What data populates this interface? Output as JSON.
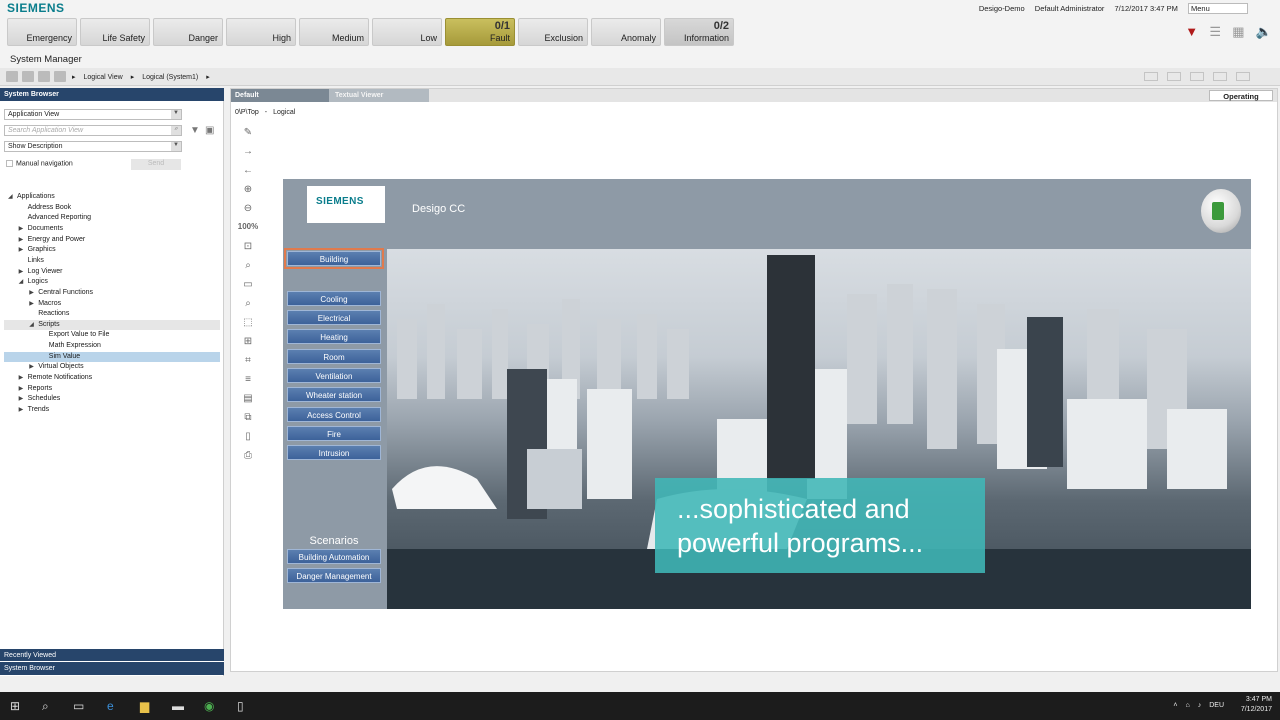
{
  "app": {
    "logo": "SIEMENS",
    "window_title": "System Manager"
  },
  "alarms": [
    {
      "label": "Emergency",
      "count": ""
    },
    {
      "label": "Life Safety",
      "count": ""
    },
    {
      "label": "Danger",
      "count": ""
    },
    {
      "label": "High",
      "count": ""
    },
    {
      "label": "Medium",
      "count": ""
    },
    {
      "label": "Low",
      "count": ""
    },
    {
      "label": "Fault",
      "count": "0/1"
    },
    {
      "label": "Exclusion",
      "count": ""
    },
    {
      "label": "Anomaly",
      "count": ""
    },
    {
      "label": "Information",
      "count": "0/2"
    }
  ],
  "user": {
    "project": "Desigo-Demo",
    "name": "Default Administrator",
    "datetime": "7/12/2017 3:47 PM",
    "menu": "Menu"
  },
  "breadcrumb": [
    "Logical View",
    "Logical (System1)"
  ],
  "system_browser": {
    "header": "System Browser",
    "view_select": "Application View",
    "search_placeholder": "Search Application View",
    "desc_select": "Show Description",
    "manual_nav": "Manual navigation",
    "send": "Send",
    "tree": [
      {
        "label": "Applications",
        "level": 0,
        "toggle": "down"
      },
      {
        "label": "Address Book",
        "level": 1,
        "toggle": ""
      },
      {
        "label": "Advanced Reporting",
        "level": 1,
        "toggle": ""
      },
      {
        "label": "Documents",
        "level": 1,
        "toggle": "right"
      },
      {
        "label": "Energy and Power",
        "level": 1,
        "toggle": "right"
      },
      {
        "label": "Graphics",
        "level": 1,
        "toggle": "right"
      },
      {
        "label": "Links",
        "level": 1,
        "toggle": ""
      },
      {
        "label": "Log Viewer",
        "level": 1,
        "toggle": "right"
      },
      {
        "label": "Logics",
        "level": 1,
        "toggle": "down"
      },
      {
        "label": "Central Functions",
        "level": 2,
        "toggle": "right"
      },
      {
        "label": "Macros",
        "level": 2,
        "toggle": "right"
      },
      {
        "label": "Reactions",
        "level": 2,
        "toggle": ""
      },
      {
        "label": "Scripts",
        "level": 2,
        "toggle": "down",
        "state": "hover"
      },
      {
        "label": "Export Value to File",
        "level": 3,
        "toggle": ""
      },
      {
        "label": "Math Expression",
        "level": 3,
        "toggle": ""
      },
      {
        "label": "Sim Value",
        "level": 3,
        "toggle": "",
        "state": "selected"
      },
      {
        "label": "Virtual Objects",
        "level": 2,
        "toggle": "right"
      },
      {
        "label": "Remote Notifications",
        "level": 1,
        "toggle": "right"
      },
      {
        "label": "Reports",
        "level": 1,
        "toggle": "right"
      },
      {
        "label": "Schedules",
        "level": 1,
        "toggle": "right"
      },
      {
        "label": "Trends",
        "level": 1,
        "toggle": "right"
      }
    ],
    "recently_viewed": "Recently Viewed",
    "footer": "System Browser"
  },
  "main": {
    "tabs": [
      "Default",
      "Textual Viewer"
    ],
    "mode": "Operating",
    "path": [
      "0\\P\\Top",
      "-",
      "Logical"
    ],
    "zoom": "100%"
  },
  "graphic": {
    "brand": "SIEMENS",
    "product": "Desigo CC",
    "menu": [
      "Building",
      "Cooling",
      "Electrical",
      "Heating",
      "Room",
      "Ventilation",
      "Wheater station",
      "Access Control",
      "Fire",
      "Intrusion"
    ],
    "scenarios_title": "Scenarios",
    "scenarios": [
      "Building Automation",
      "Danger Management"
    ]
  },
  "overlay": "...sophisticated and powerful programs...",
  "taskbar": {
    "lang": "DEU",
    "time": "3:47 PM",
    "date": "7/12/2017"
  }
}
